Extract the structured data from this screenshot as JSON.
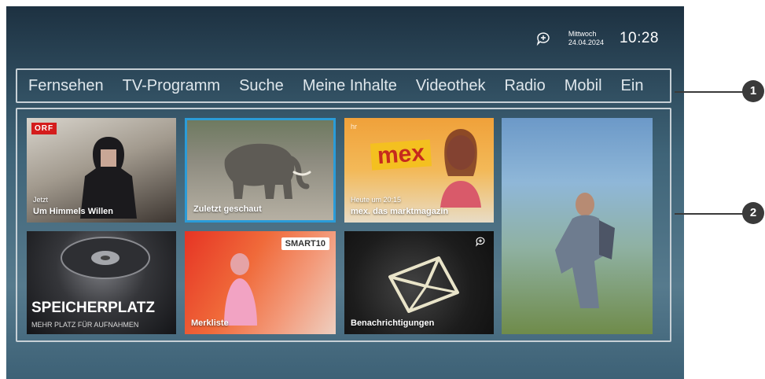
{
  "status": {
    "weekday": "Mittwoch",
    "date": "24.04.2024",
    "time": "10:28",
    "message_icon": "message-add-icon"
  },
  "nav": {
    "items": [
      "Fernsehen",
      "TV-Programm",
      "Suche",
      "Meine Inhalte",
      "Videothek",
      "Radio",
      "Mobil",
      "Ein"
    ]
  },
  "tiles": {
    "himmel": {
      "badge": "ORF",
      "sub": "Jetzt",
      "label": "Um Himmels Willen"
    },
    "zuletzt": {
      "label": "Zuletzt geschaut"
    },
    "mex": {
      "channel": "hr",
      "logo": "mex",
      "sub": "Heute um 20:15",
      "label": "mex. das marktmagazin"
    },
    "speicher": {
      "title": "SPEICHERPLATZ",
      "sub": "MEHR PLATZ FÜR AUFNAHMEN"
    },
    "merkliste": {
      "badge": "SMART10",
      "label": "Merkliste"
    },
    "benachrichtigungen": {
      "label": "Benachrichtigungen"
    }
  },
  "callouts": {
    "one": "1",
    "two": "2"
  },
  "colors": {
    "selection": "#2b9cd8",
    "frame": "#c7d0d6",
    "callout": "#3a3a3a"
  }
}
